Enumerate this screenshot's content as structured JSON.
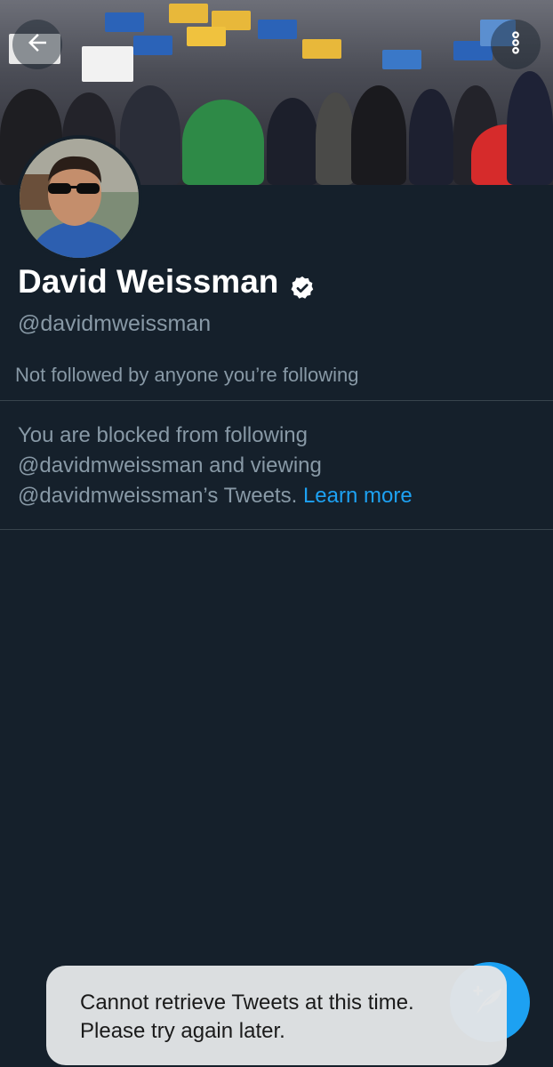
{
  "header": {
    "back_icon": "arrow-left-icon",
    "more_icon": "more-vertical-icon"
  },
  "profile": {
    "display_name": "David Weissman",
    "verified": true,
    "verified_icon": "verified-badge-icon",
    "handle": "@davidmweissman",
    "followed_by_text": "Not followed by anyone you’re following"
  },
  "blocked_notice": {
    "line1": "You are blocked from following",
    "line2": "@davidmweissman and viewing",
    "line3_prefix": "@davidmweissman’s Tweets. ",
    "learn_more_label": "Learn more"
  },
  "fab": {
    "icon": "compose-tweet-icon"
  },
  "toast": {
    "line1": "Cannot retrieve Tweets at this time.",
    "line2": "Please try again later."
  },
  "colors": {
    "background": "#15202b",
    "accent": "#1da1f2",
    "secondary_text": "#8899a6",
    "divider": "#38444d"
  }
}
